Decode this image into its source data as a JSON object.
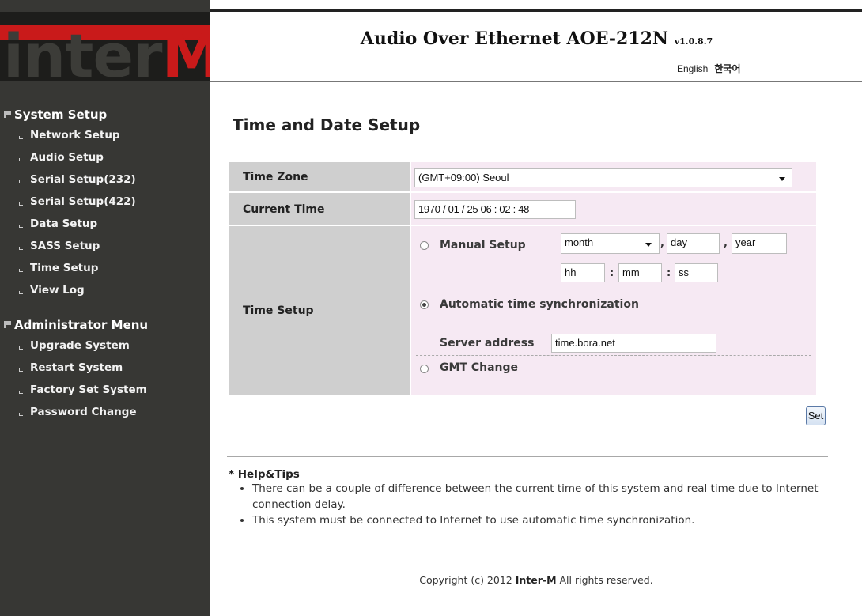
{
  "logo": {
    "text_main": "inter",
    "text_accent": "M"
  },
  "header": {
    "title": "Audio Over Ethernet AOE-212N",
    "version": "v1.0.8.7",
    "languages": [
      "English",
      "한국어"
    ]
  },
  "sidebar": {
    "sections": [
      {
        "title": "System Setup",
        "items": [
          "Network Setup",
          "Audio Setup",
          "Serial Setup(232)",
          "Serial Setup(422)",
          "Data Setup",
          "SASS Setup",
          "Time Setup",
          "View Log"
        ]
      },
      {
        "title": "Administrator Menu",
        "items": [
          "Upgrade System",
          "Restart System",
          "Factory Set System",
          "Password Change"
        ]
      }
    ]
  },
  "main": {
    "page_title": "Time and Date Setup",
    "time_zone": {
      "label": "Time Zone",
      "value": "(GMT+09:00) Seoul"
    },
    "current_time": {
      "label": "Current Time",
      "value": "1970 / 01 / 25  06 : 02 : 48"
    },
    "time_setup": {
      "label": "Time Setup",
      "manual": {
        "label": "Manual Setup",
        "selected": false,
        "month": "month",
        "day": "day",
        "year": "year",
        "hh": "hh",
        "mm": "mm",
        "ss": "ss",
        "comma": ",",
        "colon": ":"
      },
      "auto": {
        "label": "Automatic time synchronization",
        "selected": true
      },
      "server": {
        "label": "Server address",
        "value": "time.bora.net"
      },
      "gmt": {
        "label": "GMT Change",
        "selected": false
      }
    },
    "set_button": "Set"
  },
  "help": {
    "title": "* Help&Tips",
    "tips": [
      "There can be a couple of difference between the current time of this system and real time due to Internet connection delay.",
      "This system must be connected to Internet to use automatic time synchronization."
    ]
  },
  "footer": {
    "prefix": "Copyright (c) 2012 ",
    "company": "Inter-M",
    "suffix": " All rights reserved."
  },
  "colors": {
    "sidebar_bg": "#373734",
    "accent_red": "#c91a1a",
    "value_bg": "#f6e9f3",
    "label_bg": "#cfcfcf"
  }
}
